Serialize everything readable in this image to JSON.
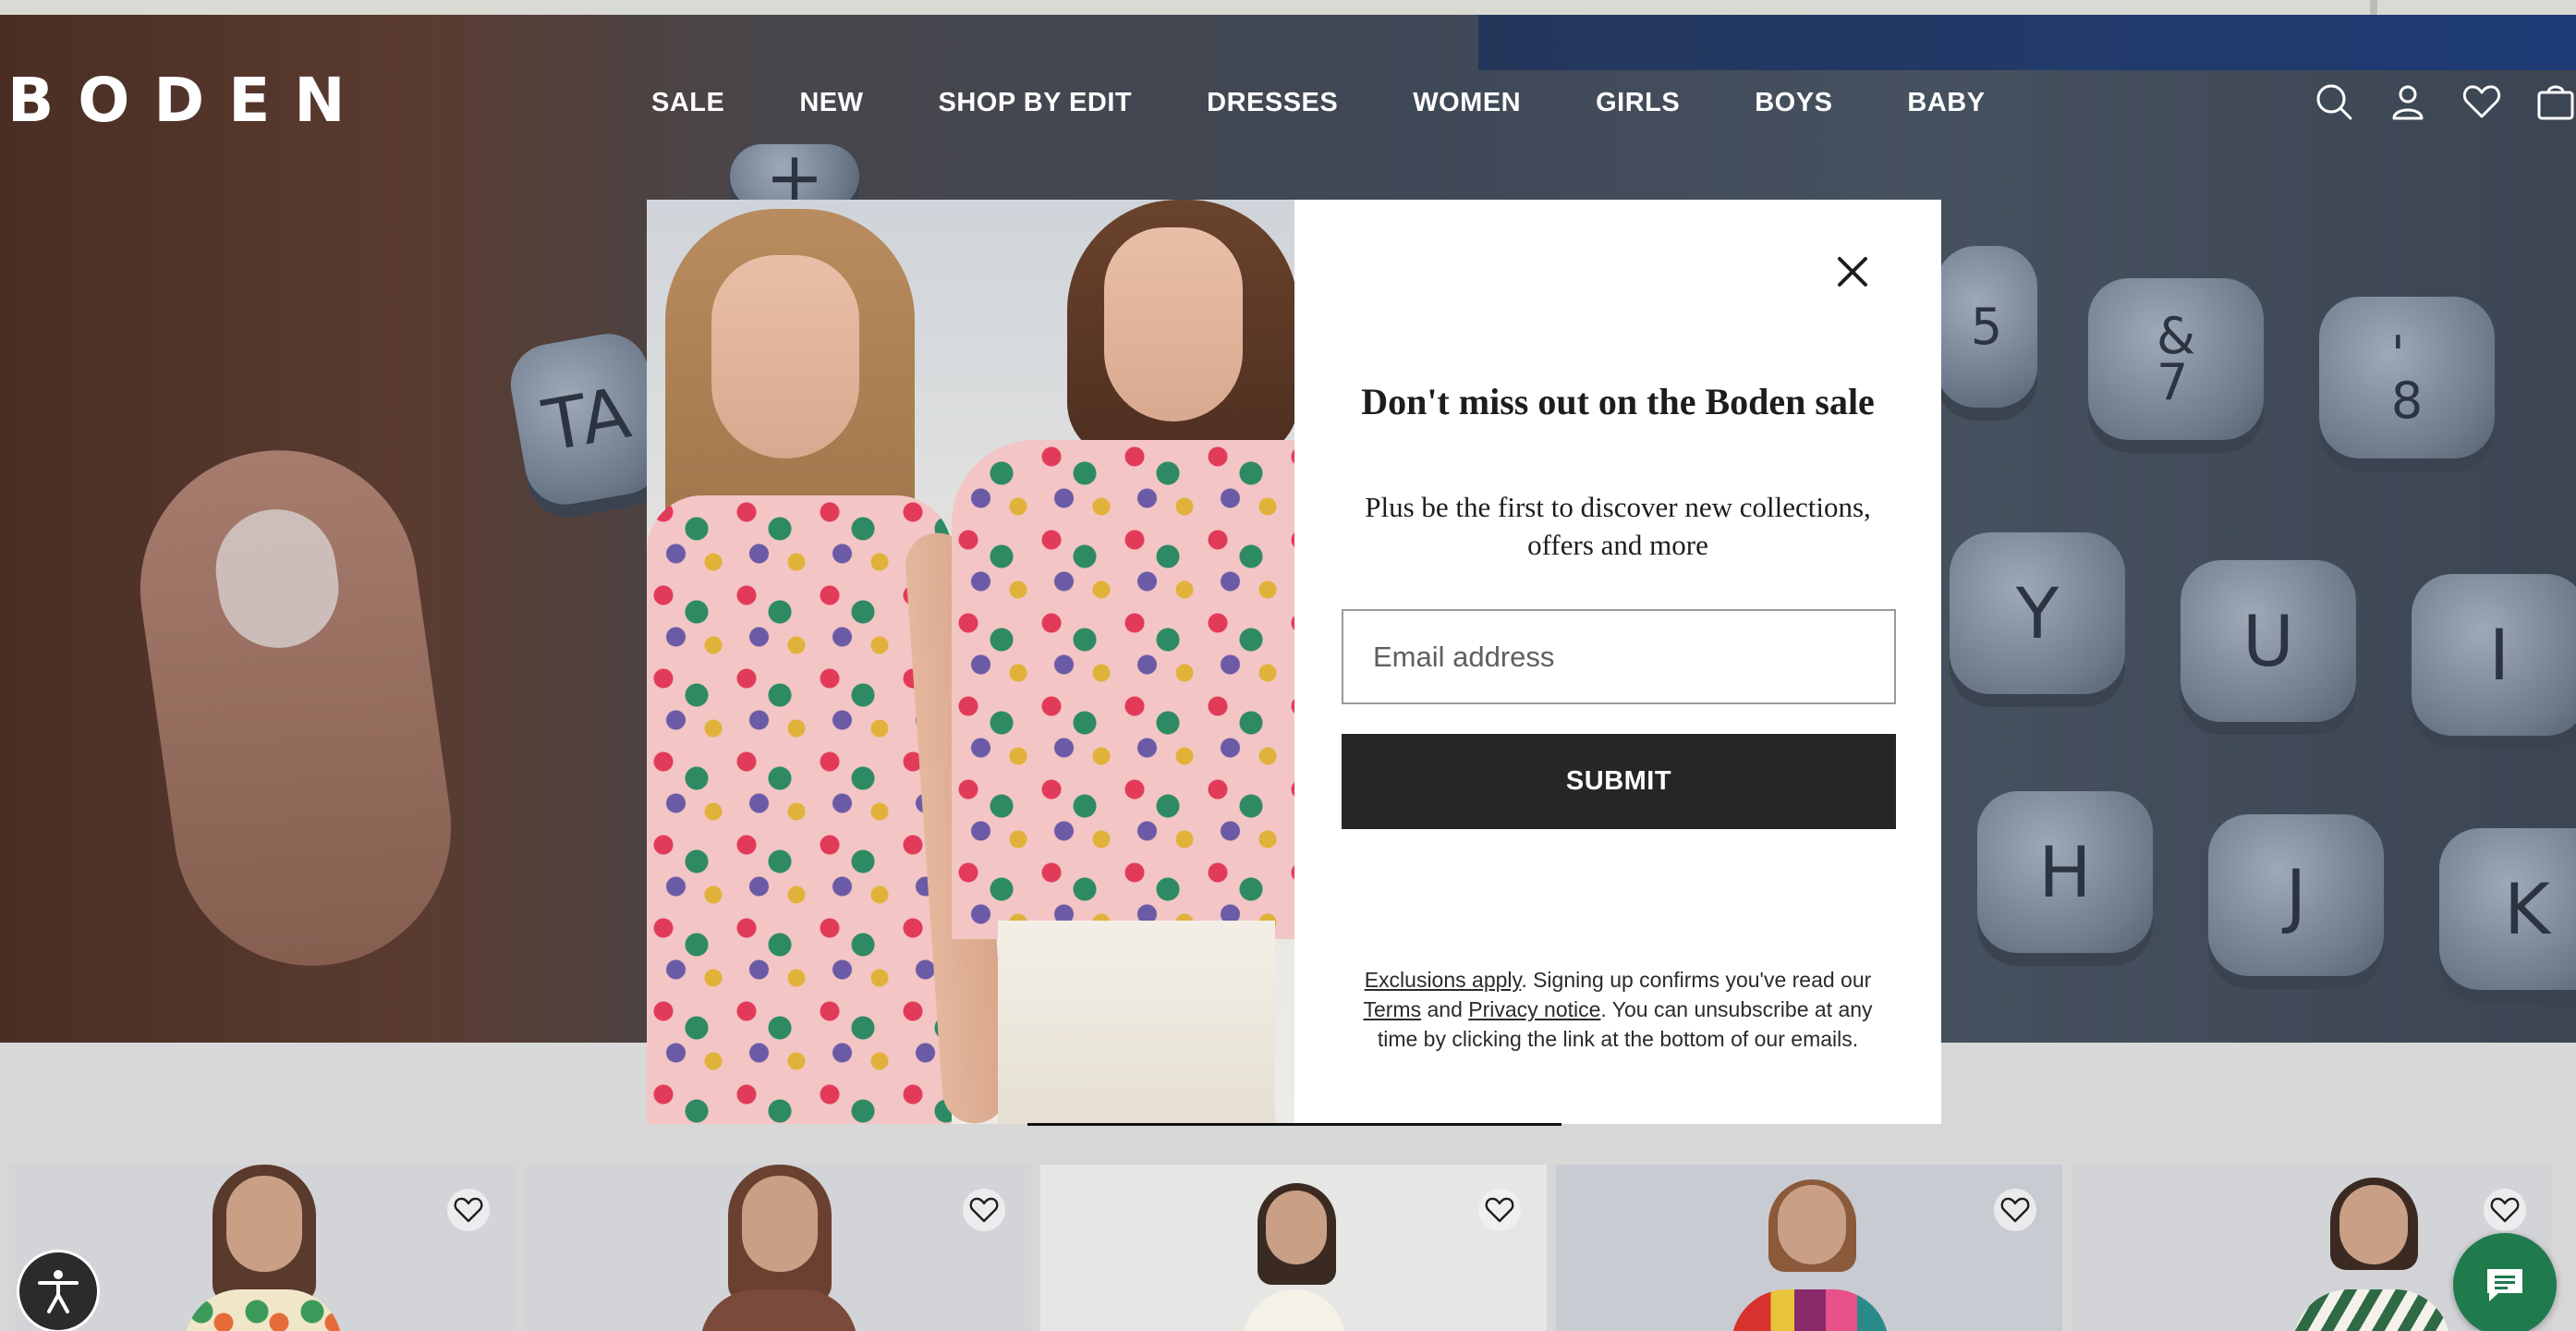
{
  "brand": {
    "logo_text": "BODEN"
  },
  "nav": {
    "items": [
      "SALE",
      "NEW",
      "SHOP BY EDIT",
      "DRESSES",
      "WOMEN",
      "GIRLS",
      "BOYS",
      "BABY"
    ]
  },
  "header_icons": [
    "search-icon",
    "account-icon",
    "wishlist-heart-icon",
    "bag-icon"
  ],
  "hero": {
    "keys": [
      {
        "label": "&\n7"
      },
      {
        "label": "'\n8"
      },
      {
        "label": "Y"
      },
      {
        "label": "U"
      },
      {
        "label": "I"
      },
      {
        "label": "H"
      },
      {
        "label": "J"
      },
      {
        "label": "K"
      },
      {
        "label": "TA"
      },
      {
        "label": "5"
      },
      {
        "label": "+"
      }
    ]
  },
  "modal": {
    "title": "Don't miss out on the Boden sale",
    "subtitle": "Plus be the first to discover new collections, offers and more",
    "email_placeholder": "Email address",
    "email_value": "",
    "submit_label": "SUBMIT",
    "legal": {
      "exclusions_link": "Exclusions apply",
      "text_1": ". Signing up confirms you've read our ",
      "terms_link": "Terms",
      "text_2": " and ",
      "privacy_link": "Privacy notice",
      "text_3": ". You can unsubscribe at any time by clicking the link at the bottom of our emails."
    },
    "close_icon": "close-icon"
  },
  "products": [
    {
      "icon": "heart-outline-icon"
    },
    {
      "icon": "heart-outline-icon"
    },
    {
      "icon": "heart-outline-icon"
    },
    {
      "icon": "heart-outline-icon"
    },
    {
      "icon": "heart-outline-icon"
    }
  ],
  "floating": {
    "accessibility_icon": "accessibility-icon",
    "chat_icon": "chat-icon"
  },
  "colors": {
    "submit_bg": "#262626",
    "chat_bg": "#1f7a4c",
    "accessibility_bg": "#2b2b2b"
  }
}
